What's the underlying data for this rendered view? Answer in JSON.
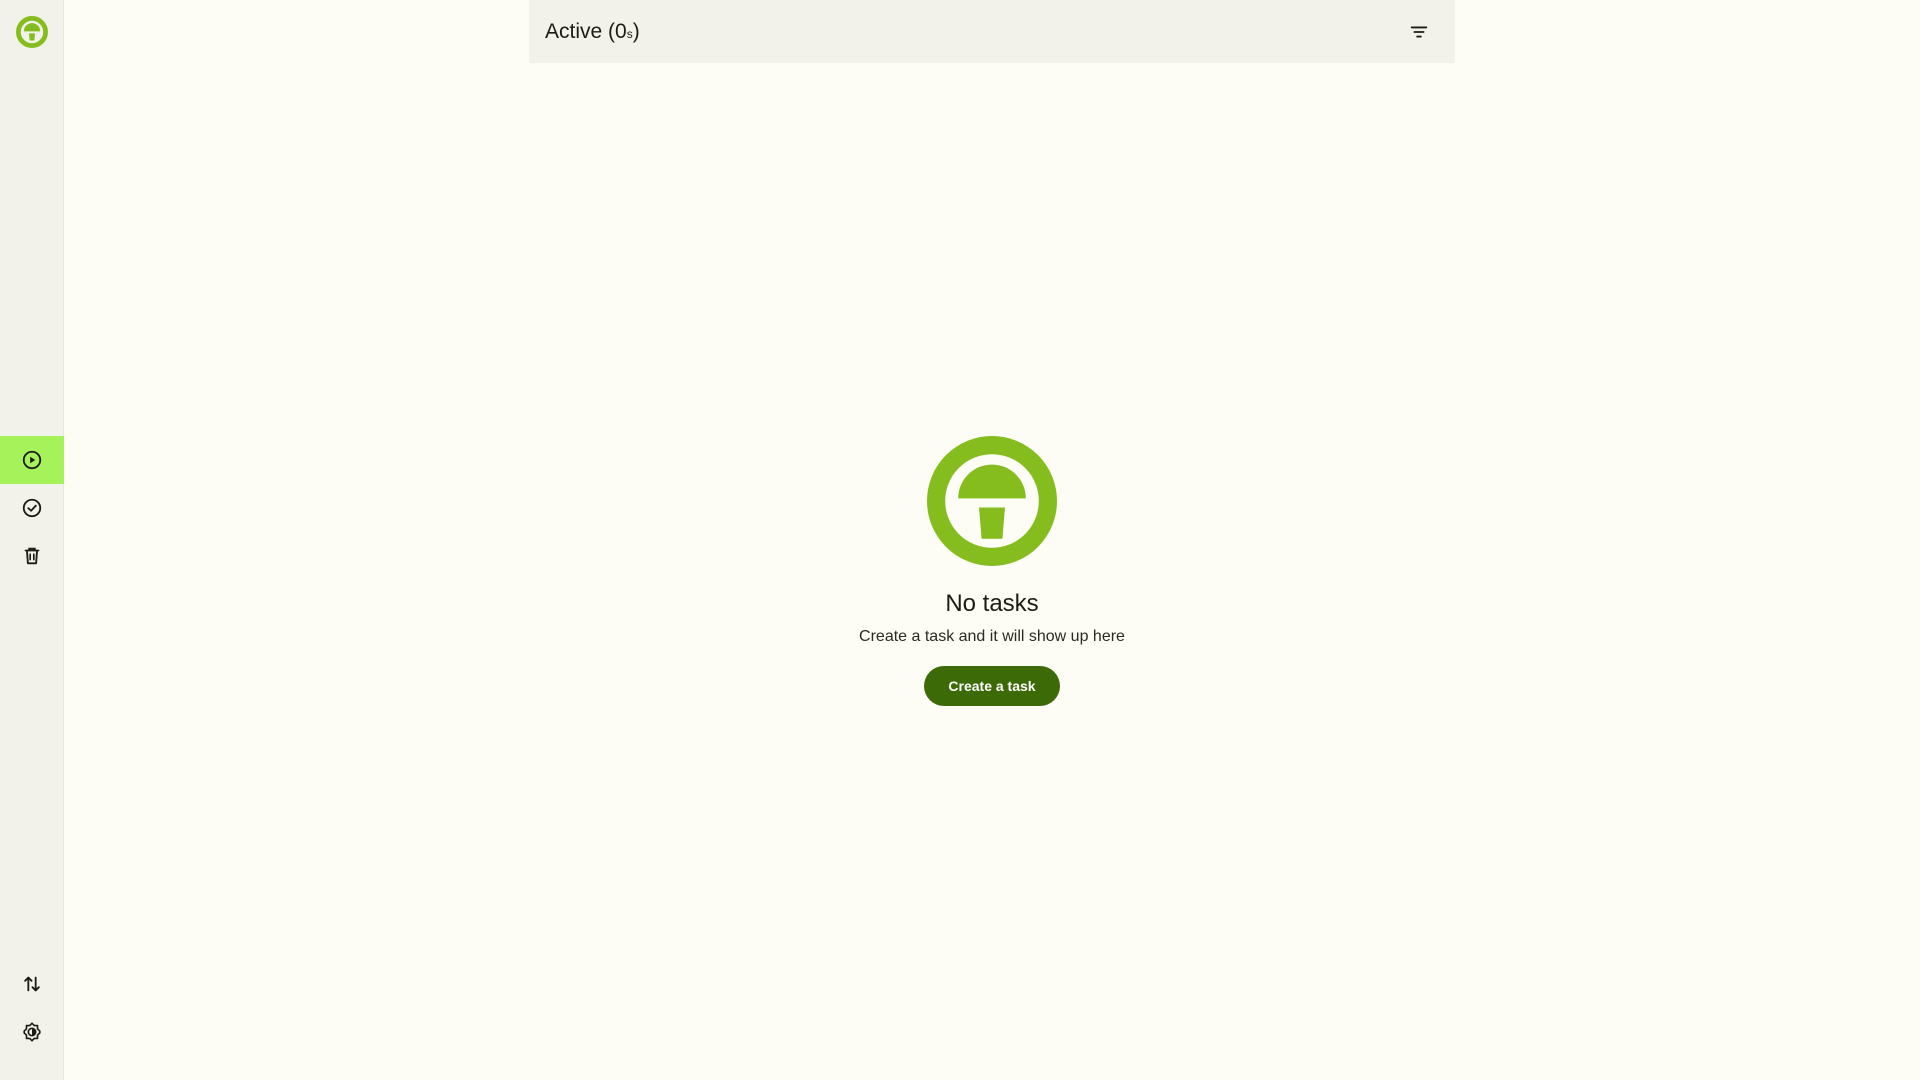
{
  "colors": {
    "accent": "#84bd1d",
    "active_nav": "#a6f25a",
    "primary_button": "#3b6a07",
    "sidebar_bg": "#f2f2ea",
    "page_bg": "#fdfdf6"
  },
  "sidebar": {
    "logo_icon": "app-logo-icon",
    "items": [
      {
        "name": "active-tasks",
        "icon": "play-circle-icon",
        "active": true
      },
      {
        "name": "completed-tasks",
        "icon": "check-circle-icon",
        "active": false
      },
      {
        "name": "deleted-tasks",
        "icon": "trash-icon",
        "active": false
      }
    ],
    "bottom_items": [
      {
        "name": "sort",
        "icon": "swap-vertical-icon"
      },
      {
        "name": "theme-settings",
        "icon": "brightness-gear-icon"
      }
    ]
  },
  "header": {
    "title_main": "Active (0",
    "title_sub": "s",
    "title_close": ")",
    "filter_icon": "filter-icon"
  },
  "empty_state": {
    "title": "No tasks",
    "subtitle": "Create a task and it will show up here",
    "button_label": "Create a task"
  }
}
